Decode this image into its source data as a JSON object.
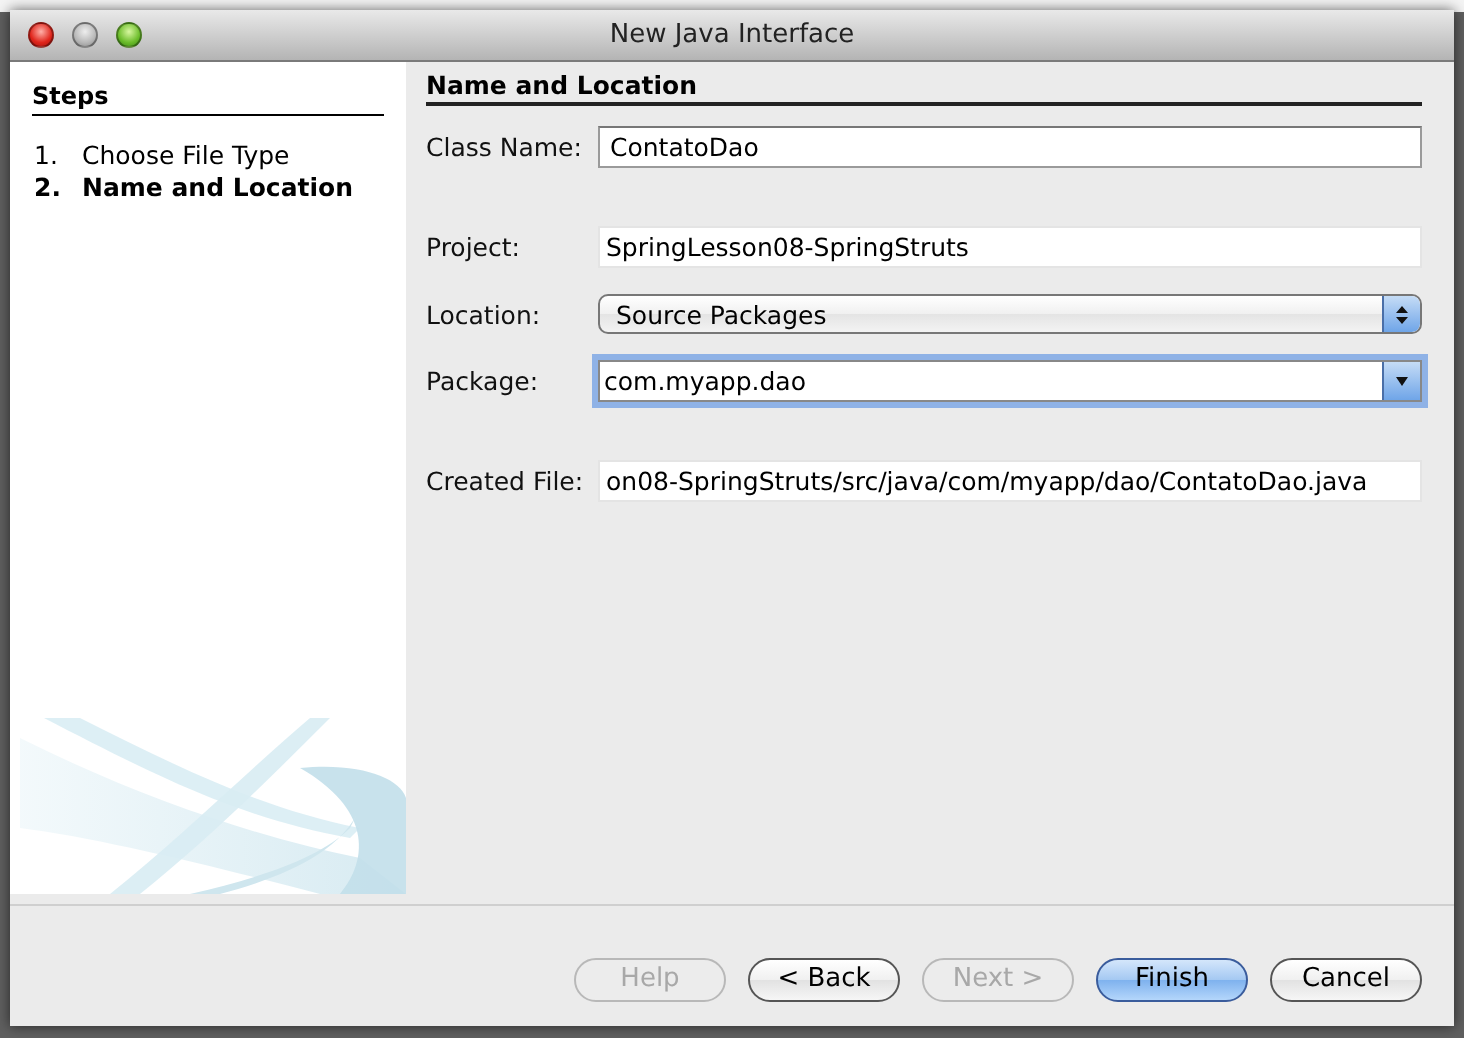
{
  "window": {
    "title": "New Java Interface"
  },
  "steps": {
    "title": "Steps",
    "items": [
      {
        "number": "1.",
        "label": "Choose File Type",
        "selected": false
      },
      {
        "number": "2.",
        "label": "Name and Location",
        "selected": true
      }
    ]
  },
  "panel": {
    "title": "Name and Location",
    "groups": [
      [
        {
          "kind": "text",
          "label": "Class Name:",
          "value": "ContatoDao",
          "focused": false
        }
      ],
      [
        {
          "kind": "readonly",
          "label": "Project:",
          "value": "SpringLesson08-SpringStruts",
          "focused": false
        },
        {
          "kind": "select",
          "label": "Location:",
          "value": "Source Packages",
          "focused": false
        },
        {
          "kind": "combo",
          "label": "Package:",
          "value": "com.myapp.dao",
          "focused": true
        }
      ],
      [
        {
          "kind": "readonly",
          "label": "Created File:",
          "value": "on08-SpringStruts/src/java/com/myapp/dao/ContatoDao.java",
          "focused": false
        }
      ]
    ]
  },
  "buttons": [
    {
      "label": "Help",
      "disabled": true,
      "default": false
    },
    {
      "label": "< Back",
      "disabled": false,
      "default": false
    },
    {
      "label": "Next >",
      "disabled": true,
      "default": false
    },
    {
      "label": "Finish",
      "disabled": false,
      "default": true
    },
    {
      "label": "Cancel",
      "disabled": false,
      "default": false
    }
  ]
}
